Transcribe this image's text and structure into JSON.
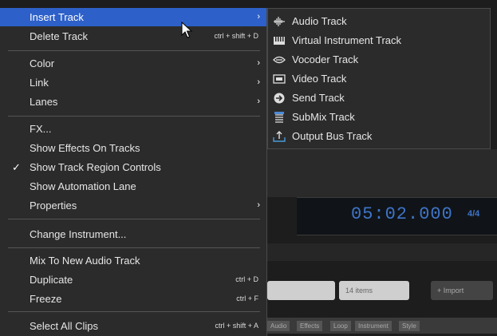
{
  "background": {
    "time_display": "05:02.000",
    "time_signature": "4/4",
    "search_hint": "14 items",
    "import_button": "+ Import",
    "tabs": [
      "Audio",
      "Effects",
      "Loop",
      "Instrument",
      "Style"
    ]
  },
  "menu": {
    "items": [
      {
        "label": "Insert Track",
        "shortcut": "",
        "submenu": true
      },
      {
        "label": "Delete Track",
        "shortcut": "ctrl + shift + D"
      },
      {
        "label": "Color",
        "submenu": true
      },
      {
        "label": "Link",
        "submenu": true
      },
      {
        "label": "Lanes",
        "submenu": true
      },
      {
        "label": "FX..."
      },
      {
        "label": "Show Effects On Tracks"
      },
      {
        "label": "Show Track Region Controls",
        "checked": true,
        "check_mark": "✓"
      },
      {
        "label": "Show Automation Lane"
      },
      {
        "label": "Properties",
        "submenu": true
      },
      {
        "label": "Change Instrument..."
      },
      {
        "label": "Mix To New Audio Track"
      },
      {
        "label": "Duplicate",
        "shortcut": "ctrl + D"
      },
      {
        "label": "Freeze",
        "shortcut": "ctrl + F"
      },
      {
        "label": "Select All Clips",
        "shortcut": "ctrl + shift + A"
      }
    ],
    "submenu_arrow": "›"
  },
  "submenu": {
    "items": [
      {
        "label": "Audio Track",
        "icon": "waveform-icon"
      },
      {
        "label": "Virtual Instrument Track",
        "icon": "piano-keys-icon"
      },
      {
        "label": "Vocoder Track",
        "icon": "vocoder-icon"
      },
      {
        "label": "Video Track",
        "icon": "video-icon"
      },
      {
        "label": "Send Track",
        "icon": "arrow-circle-icon"
      },
      {
        "label": "SubMix Track",
        "icon": "submix-icon"
      },
      {
        "label": "Output Bus Track",
        "icon": "output-icon"
      }
    ]
  },
  "colors": {
    "highlight": "#2d60c8",
    "menu_bg": "#2b2b2b",
    "time_display": "#3f74c8"
  }
}
